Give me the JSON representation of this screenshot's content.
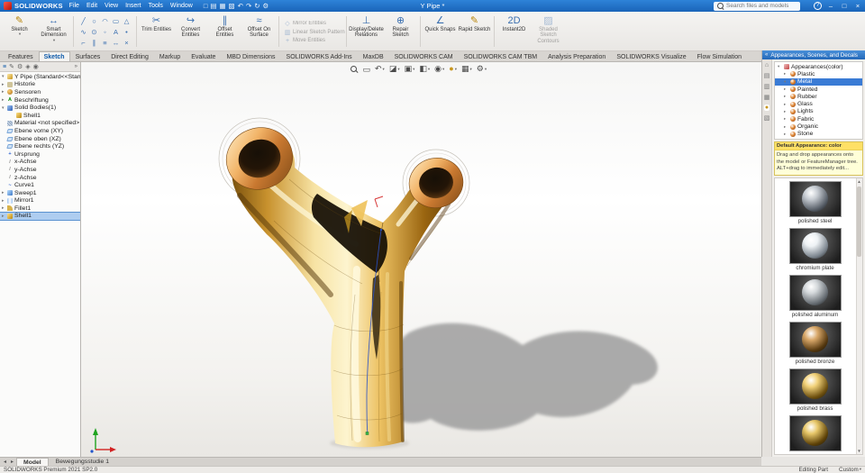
{
  "colors": {
    "accent": "#2b7cd3",
    "titlebar": "#1f6fc4",
    "selection": "#aecdf0",
    "gold": "#d9a94e"
  },
  "titlebar": {
    "app_name": "SOLIDWORKS",
    "menus": [
      "File",
      "Edit",
      "View",
      "Insert",
      "Tools",
      "Window"
    ],
    "quick_icons": [
      "□",
      "▤",
      "▦",
      "▧",
      "↶",
      "↷",
      "↻",
      "⚙"
    ],
    "doc_title": "Y Pipe *",
    "search_placeholder": "Search files and models",
    "help": "?",
    "window_controls": {
      "minimize": "–",
      "maximize": "□",
      "close": "×"
    }
  },
  "ribbon": {
    "big": [
      "Sketch",
      "Smart Dimension",
      "Trim Entities",
      "Convert Entities",
      "Offset Entities",
      "Offset On Surface",
      "Display/Delete Relations",
      "Repair Sketch",
      "Quick Snaps",
      "Rapid Sketch",
      "Instant2D",
      "Shaded Sketch Contours"
    ],
    "big_icons": [
      "✎",
      "↔",
      "✂",
      "↪",
      "∥",
      "≈",
      "⊥",
      "⊕",
      "∠",
      "✎",
      "2D",
      "▨"
    ],
    "stacked": [
      "Mirror Entities",
      "Linear Sketch Pattern",
      "Move Entities"
    ],
    "stacked_icons": [
      "◇",
      "▥",
      "+"
    ],
    "entity_icons": [
      "╱",
      "○",
      "◠",
      "▭",
      "△",
      "∿",
      "⊙",
      "◦",
      "A",
      "•",
      "⌐",
      "∥",
      "≡",
      "↔",
      "×"
    ]
  },
  "command_tabs": {
    "items": [
      "Features",
      "Sketch",
      "Surfaces",
      "Direct Editing",
      "Markup",
      "Evaluate",
      "MBD Dimensions",
      "SOLIDWORKS Add-Ins",
      "MaxDB",
      "SOLIDWORKS CAM",
      "SOLIDWORKS CAM TBM",
      "Analysis Preparation",
      "SOLIDWORKS Visualize",
      "Flow Simulation"
    ],
    "active": "Sketch"
  },
  "feature_tree": {
    "tab_icons": [
      "≡",
      "✎",
      "⚙",
      "◈",
      "◉"
    ],
    "root": "Y Pipe (Standard<<Standard>_Anzeige",
    "items": [
      {
        "label": "Historie",
        "glyph": ""
      },
      {
        "label": "Sensoren",
        "glyph": ""
      },
      {
        "label": "Beschriftung",
        "glyph": "A"
      },
      {
        "label": "Solid Bodies(1)",
        "glyph": ""
      },
      {
        "label": "Shell1",
        "glyph": ""
      },
      {
        "label": "Material <not specified>",
        "glyph": ""
      },
      {
        "label": "Ebene vorne (XY)",
        "glyph": ""
      },
      {
        "label": "Ebene oben (XZ)",
        "glyph": ""
      },
      {
        "label": "Ebene rechts (YZ)",
        "glyph": ""
      },
      {
        "label": "Ursprung",
        "glyph": "+"
      },
      {
        "label": "x-Achse",
        "glyph": "/"
      },
      {
        "label": "y-Achse",
        "glyph": "/"
      },
      {
        "label": "z-Achse",
        "glyph": "/"
      },
      {
        "label": "Curve1",
        "glyph": "~"
      },
      {
        "label": "Sweep1",
        "glyph": ""
      },
      {
        "label": "Mirror1",
        "glyph": ""
      },
      {
        "label": "Fillet1",
        "glyph": ""
      },
      {
        "label": "Shell1",
        "glyph": ""
      }
    ]
  },
  "viewport": {
    "toolbar_icons": [
      "▭",
      "↶",
      "◪",
      "▣",
      "◧",
      "◉",
      "●",
      "▦",
      "⚙"
    ]
  },
  "task_pane": {
    "side_icons": [
      "⌂",
      "▤",
      "▥",
      "▦",
      "●",
      "▧"
    ],
    "title": "Appearances, Scenes, and Decals",
    "tree": [
      {
        "label": "Appearances(color)"
      },
      {
        "label": "Plastic"
      },
      {
        "label": "Metal"
      },
      {
        "label": "Painted"
      },
      {
        "label": "Rubber"
      },
      {
        "label": "Glass"
      },
      {
        "label": "Lights"
      },
      {
        "label": "Fabric"
      },
      {
        "label": "Organic"
      },
      {
        "label": "Stone"
      }
    ],
    "selected": "Metal",
    "info_title": "Default Appearance: color",
    "info_body": "Drag and drop appearances onto the model or FeatureManager tree. ALT+drag to immediately edit...",
    "swatches": [
      {
        "name": "polished steel",
        "hi": "#c7ccd2",
        "lo": "#565d66"
      },
      {
        "name": "chromium plate",
        "hi": "#eef2f5",
        "lo": "#7c858e"
      },
      {
        "name": "polished aluminum",
        "hi": "#d4d8db",
        "lo": "#666c72"
      },
      {
        "name": "polished bronze",
        "hi": "#d9a86a",
        "lo": "#55380f"
      },
      {
        "name": "polished brass",
        "hi": "#f2d27a",
        "lo": "#6e500f"
      },
      {
        "name": "",
        "hi": "#e8c86a",
        "lo": "#5e4208"
      }
    ]
  },
  "doc_tabs": {
    "items": [
      "Model",
      "Bewegungsstudie 1"
    ],
    "active": "Model"
  },
  "status": {
    "left": "SOLIDWORKS Premium 2021 SP2.0",
    "mode": "Editing Part",
    "units": "Custom"
  }
}
